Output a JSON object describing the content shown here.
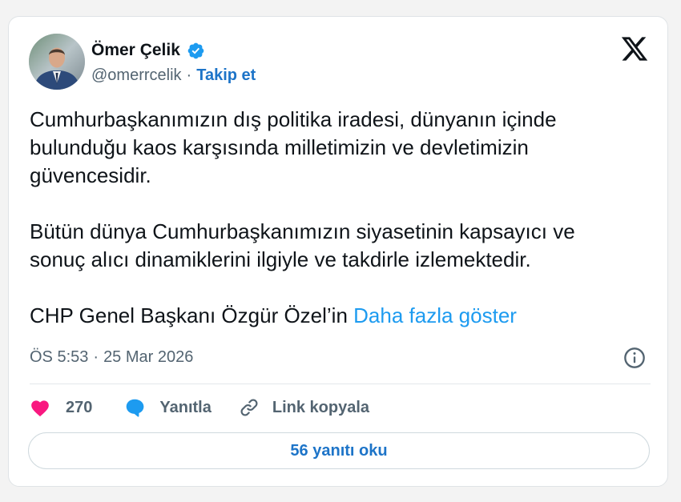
{
  "author": {
    "name": "Ömer Çelik",
    "handle": "@omerrcelik",
    "separator": "·",
    "follow_label": "Takip et"
  },
  "tweet": {
    "paragraphs": [
      "Cumhurbaşkanımızın dış politika iradesi, dünyanın içinde\nbulunduğu kaos karşısında milletimizin ve devletimizin\ngüvencesidir.",
      "Bütün dünya Cumhurbaşkanımızın siyasetinin kapsayıcı ve\nsonuç alıcı dinamiklerini ilgiyle ve takdirle izlemektedir."
    ],
    "truncated_text": "CHP Genel Başkanı Özgür Özel’in ",
    "show_more_label": "Daha fazla göster",
    "time": "ÖS 5:53",
    "date_separator": "·",
    "date": "25 Mar 2026"
  },
  "actions": {
    "like_count": "270",
    "reply_label": "Yanıtla",
    "copy_link_label": "Link kopyala"
  },
  "footer": {
    "read_replies_label": "56 yanıtı oku"
  },
  "colors": {
    "link": "#1d9bf0",
    "action_blue": "#1d74c8",
    "heart": "#f91880",
    "verified": "#1d9bf0",
    "muted_text": "#536471"
  },
  "icons": [
    "verified-badge-icon",
    "x-logo-icon",
    "info-icon",
    "heart-icon",
    "reply-bubble-icon",
    "link-icon"
  ]
}
